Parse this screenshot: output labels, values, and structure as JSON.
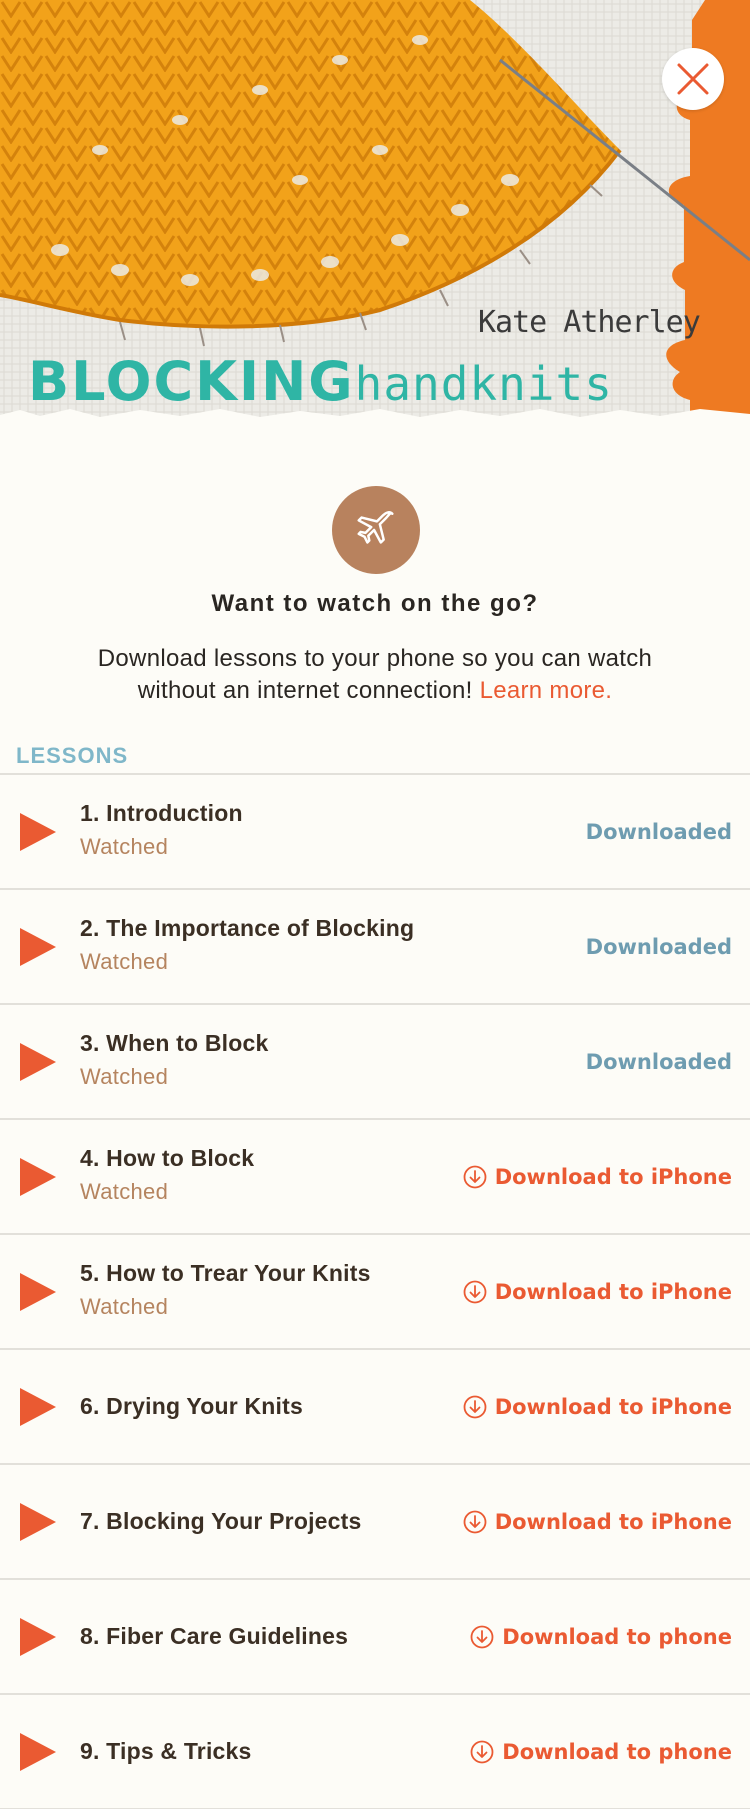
{
  "hero": {
    "author": "Kate Atherley",
    "title_main": "BLOCKING",
    "title_script": "handknits"
  },
  "promo": {
    "heading": "Want to watch on the go?",
    "body": "Download lessons to your phone so you can watch without an internet connection!",
    "link": "Learn more."
  },
  "lessons_label": "LESSONS",
  "lessons": [
    {
      "title": "1. Introduction",
      "status": "Watched",
      "action": "Downloaded",
      "state": "downloaded"
    },
    {
      "title": "2. The Importance of Blocking",
      "status": "Watched",
      "action": "Downloaded",
      "state": "downloaded"
    },
    {
      "title": "3. When to Block",
      "status": "Watched",
      "action": "Downloaded",
      "state": "downloaded"
    },
    {
      "title": "4. How to Block",
      "status": "Watched",
      "action": "Download to iPhone",
      "state": "download"
    },
    {
      "title": "5. How to Trear Your Knits",
      "status": "Watched",
      "action": "Download to iPhone",
      "state": "download"
    },
    {
      "title": "6. Drying Your Knits",
      "status": "",
      "action": "Download to iPhone",
      "state": "download"
    },
    {
      "title": "7. Blocking Your Projects",
      "status": "",
      "action": "Download to iPhone",
      "state": "download"
    },
    {
      "title": "8. Fiber Care Guidelines",
      "status": "",
      "action": "Download to phone",
      "state": "download"
    },
    {
      "title": "9. Tips & Tricks",
      "status": "",
      "action": "Download to phone",
      "state": "download"
    }
  ],
  "colors": {
    "accent": "#ea5a32",
    "downloaded": "#6e9cb0",
    "section_label": "#7fb7c9",
    "watched": "#b5845f",
    "promo_icon_bg": "#b8825e",
    "title_teal": "#2fb5a5"
  },
  "icons": {
    "close": "close-icon",
    "promo": "airplane-icon",
    "play": "play-icon",
    "download": "download-arrow-icon"
  }
}
